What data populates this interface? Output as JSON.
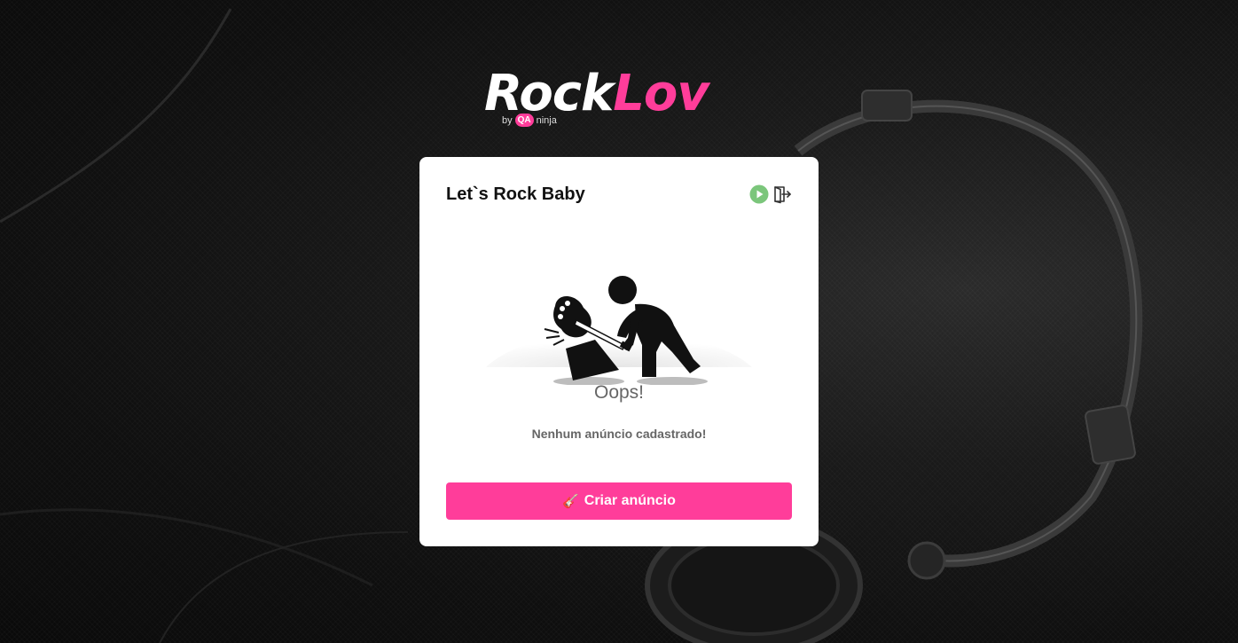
{
  "brand": {
    "name_part1": "Rock",
    "name_part2": "Lov",
    "byline": "by",
    "qa_badge": "QA",
    "byline_suffix": "ninja",
    "accent_color": "#ff3d9a"
  },
  "card": {
    "title": "Let`s Rock Baby",
    "actions": [
      {
        "name": "play-icon",
        "color": "#7bc67b"
      },
      {
        "name": "logout-icon",
        "color": "#333333"
      }
    ],
    "empty_state": {
      "heading": "Oops!",
      "message": "Nenhum anúncio cadastrado!"
    },
    "cta": {
      "icon": "🎸",
      "label": "Criar anúncio"
    }
  }
}
